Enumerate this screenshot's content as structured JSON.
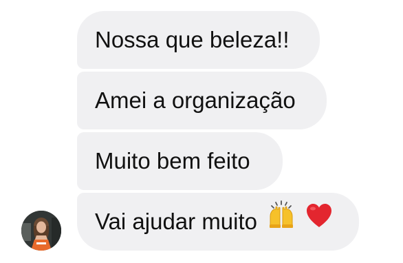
{
  "conversation": {
    "messages": [
      {
        "text": "Nossa que beleza!!"
      },
      {
        "text": "Amei a organização"
      },
      {
        "text": "Muito bem feito"
      },
      {
        "text": "Vai ajudar muito",
        "emojis": [
          "raising-hands-emoji",
          "red-heart-emoji"
        ]
      }
    ],
    "sender_avatar": "avatar"
  },
  "colors": {
    "bubble_background": "#f0f0f2",
    "text": "#111111",
    "heart": "#e3262f",
    "hands": "#f6c12a"
  }
}
